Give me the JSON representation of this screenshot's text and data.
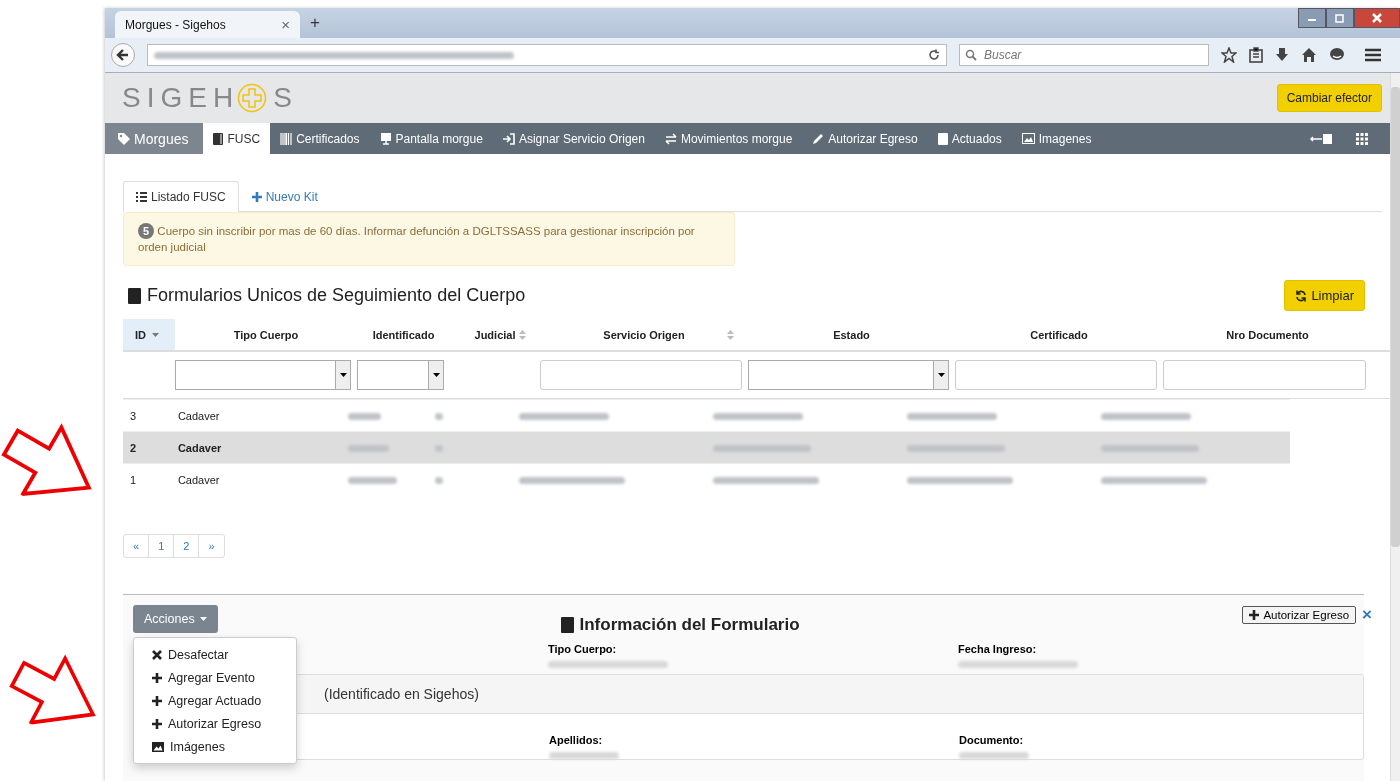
{
  "browser": {
    "tab_title": "Morgues - Sigehos",
    "tab_close": "×",
    "new_tab": "+",
    "search_placeholder": "Buscar"
  },
  "app": {
    "logo_before": "SIGEH",
    "logo_after": "S",
    "header_button": "Cambiar efector"
  },
  "nav": [
    {
      "label": "Morgues",
      "kind": "brand",
      "selected": false
    },
    {
      "label": "FUSC",
      "kind": "book",
      "selected": true
    },
    {
      "label": "Certificados",
      "kind": "barcode",
      "selected": false
    },
    {
      "label": "Pantalla morgue",
      "kind": "screen",
      "selected": false
    },
    {
      "label": "Asignar Servicio Origen",
      "kind": "login",
      "selected": false
    },
    {
      "label": "Movimientos morgue",
      "kind": "swap",
      "selected": false
    },
    {
      "label": "Autorizar Egreso",
      "kind": "pencil",
      "selected": false
    },
    {
      "label": "Actuados",
      "kind": "book",
      "selected": false
    },
    {
      "label": "Imagenes",
      "kind": "picture",
      "selected": false
    }
  ],
  "subtabs": [
    {
      "label": "Listado FUSC",
      "kind": "list",
      "selected": true
    },
    {
      "label": "Nuevo Kit",
      "kind": "plus",
      "selected": false
    }
  ],
  "alert": {
    "badge": "5",
    "text": "Cuerpo sin inscribir por mas de 60 días. Informar defunción a DGLTSSASS para gestionar inscripción por orden judicial"
  },
  "heading": "Formularios Unicos de Seguimiento del Cuerpo",
  "refresh_button": "Limpiar",
  "table": {
    "columns": [
      {
        "label": "ID",
        "kind": "plain",
        "sorted": true,
        "sortable": false,
        "selected": true
      },
      {
        "label": "Tipo Cuerpo",
        "kind": "select",
        "sorted": false,
        "sortable": false,
        "selected": false
      },
      {
        "label": "Identificado",
        "kind": "select",
        "sorted": false,
        "sortable": false,
        "selected": false
      },
      {
        "label": "Judicial",
        "kind": "plain",
        "sorted": false,
        "sortable": true,
        "selected": false
      },
      {
        "label": "Servicio Origen",
        "kind": "text",
        "sorted": false,
        "sortable": true,
        "selected": false
      },
      {
        "label": "Estado",
        "kind": "select",
        "sorted": false,
        "sortable": false,
        "selected": false
      },
      {
        "label": "Certificado",
        "kind": "text",
        "sorted": false,
        "sortable": false,
        "selected": false
      },
      {
        "label": "Nro Documento",
        "kind": "text",
        "sorted": false,
        "sortable": false,
        "selected": false
      }
    ],
    "rows": [
      {
        "selected": false,
        "cells": [
          {
            "kind": "text",
            "text": "3"
          },
          {
            "kind": "text",
            "text": "Cadaver"
          },
          {
            "kind": "redacted"
          },
          {
            "kind": "redacted"
          },
          {
            "kind": "redacted"
          },
          {
            "kind": "redacted"
          },
          {
            "kind": "redacted"
          },
          {
            "kind": "redacted"
          }
        ]
      },
      {
        "selected": true,
        "cells": [
          {
            "kind": "text",
            "text": "2"
          },
          {
            "kind": "text",
            "text": "Cadaver"
          },
          {
            "kind": "redacted"
          },
          {
            "kind": "redacted"
          },
          {
            "kind": "empty"
          },
          {
            "kind": "redacted"
          },
          {
            "kind": "redacted"
          },
          {
            "kind": "redacted"
          }
        ]
      },
      {
        "selected": false,
        "cells": [
          {
            "kind": "text",
            "text": "1"
          },
          {
            "kind": "text",
            "text": "Cadaver"
          },
          {
            "kind": "redacted"
          },
          {
            "kind": "redacted"
          },
          {
            "kind": "redacted"
          },
          {
            "kind": "redacted"
          },
          {
            "kind": "redacted"
          },
          {
            "kind": "redacted"
          }
        ]
      }
    ]
  },
  "pagination": [
    "«",
    "1",
    "2",
    "»"
  ],
  "detail": {
    "actions_button": "Acciones",
    "menu": [
      {
        "label": "Desafectar",
        "kind": "close"
      },
      {
        "label": "Agregar Evento",
        "kind": "plus"
      },
      {
        "label": "Agregar Actuado",
        "kind": "plus"
      },
      {
        "label": "Autorizar Egreso",
        "kind": "plus"
      },
      {
        "label": "Imágenes",
        "kind": "picture"
      }
    ],
    "title": "Información del Formulario",
    "authorize_button": "Autorizar Egreso",
    "close": "×",
    "fields": [
      {
        "label": "Tipo Cuerpo:"
      },
      {
        "label": "Fecha Ingreso:"
      }
    ],
    "section_title": "(Identificado en Sigehos)",
    "section_fields": [
      {
        "label": "Apellidos:"
      },
      {
        "label": "Documento:"
      }
    ]
  }
}
